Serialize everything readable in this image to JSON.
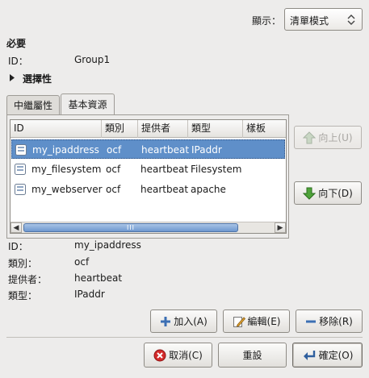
{
  "display": {
    "label": "顯示：",
    "selected": "清單模式"
  },
  "required": {
    "section_title": "必要",
    "id_label": "ID：",
    "id_value": "Group1"
  },
  "optional": {
    "section_title": "選擇性"
  },
  "tabs": [
    {
      "label": "中繼屬性"
    },
    {
      "label": "基本資源"
    }
  ],
  "table": {
    "columns": [
      "ID",
      "類別",
      "提供者",
      "類型",
      "樣板"
    ],
    "rows": [
      {
        "id": "my_ipaddress",
        "class": "ocf",
        "provider": "heartbeat",
        "type": "IPaddr",
        "selected": true
      },
      {
        "id": "my_filesystem",
        "class": "ocf",
        "provider": "heartbeat",
        "type": "Filesystem",
        "selected": false
      },
      {
        "id": "my_webserver",
        "class": "ocf",
        "provider": "heartbeat",
        "type": "apache",
        "selected": false
      }
    ],
    "scroll_thumb_grip": "III"
  },
  "move_buttons": {
    "up": "向上(U)",
    "down": "向下(D)"
  },
  "details": {
    "id_label": "ID：",
    "id_value": "my_ipaddress",
    "class_label": "類別：",
    "class_value": "ocf",
    "provider_label": "提供者：",
    "provider_value": "heartbeat",
    "type_label": "類型：",
    "type_value": "IPaddr"
  },
  "actions": {
    "add": "加入(A)",
    "edit": "編輯(E)",
    "remove": "移除(R)"
  },
  "dialog": {
    "cancel": "取消(C)",
    "reset": "重設",
    "ok": "確定(O)"
  },
  "colors": {
    "selection": "#5f8fc9",
    "background": "#edeceb"
  }
}
